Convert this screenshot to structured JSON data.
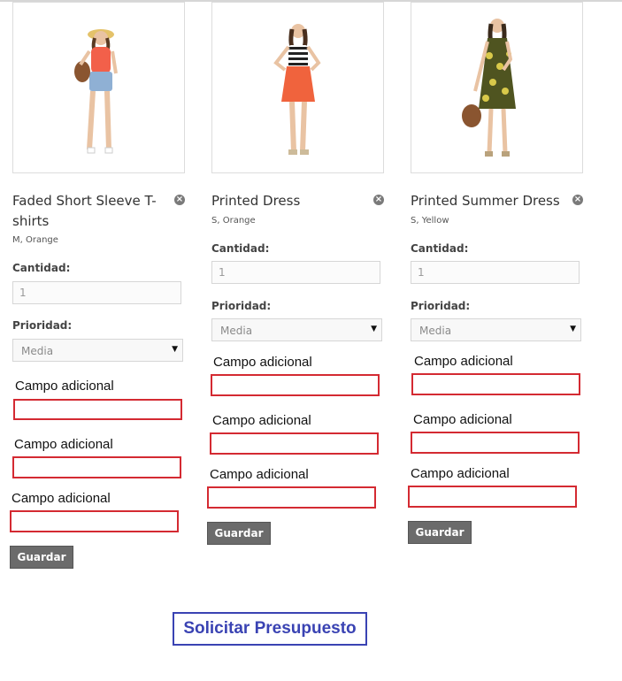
{
  "products": [
    {
      "name": "Faded Short Sleeve T-shirts",
      "attributes": "M, Orange",
      "quantity_label": "Cantidad:",
      "quantity_value": "1",
      "priority_label": "Prioridad:",
      "priority_value": "Media",
      "remove_icon": "close-circle-icon",
      "extra_fields": [
        "Campo adicional",
        "Campo adicional",
        "Campo adicional"
      ],
      "save_label": "Guardar",
      "image_colors": {
        "top": "#f2604a",
        "bottom": "#8fb0d4",
        "accent": "#e4c26a"
      }
    },
    {
      "name": "Printed Dress",
      "attributes": "S, Orange",
      "quantity_label": "Cantidad:",
      "quantity_value": "1",
      "priority_label": "Prioridad:",
      "priority_value": "Media",
      "remove_icon": "close-circle-icon",
      "extra_fields": [
        "Campo adicional",
        "Campo adicional",
        "Campo adicional"
      ],
      "save_label": "Guardar",
      "image_colors": {
        "top": "#222222",
        "bottom": "#f0633d",
        "accent": "#ffffff"
      }
    },
    {
      "name": "Printed Summer Dress",
      "attributes": "S, Yellow",
      "quantity_label": "Cantidad:",
      "quantity_value": "1",
      "priority_label": "Prioridad:",
      "priority_value": "Media",
      "remove_icon": "close-circle-icon",
      "extra_fields": [
        "Campo adicional",
        "Campo adicional",
        "Campo adicional"
      ],
      "save_label": "Guardar",
      "image_colors": {
        "top": "#4f5420",
        "bottom": "#5b5a22",
        "accent": "#d9c94a"
      }
    }
  ],
  "request_quote_label": "Solicitar Presupuesto",
  "colors": {
    "extra_field_border": "#d42a32",
    "button_bg": "#6b6b6b",
    "cta": "#3a43b3"
  }
}
